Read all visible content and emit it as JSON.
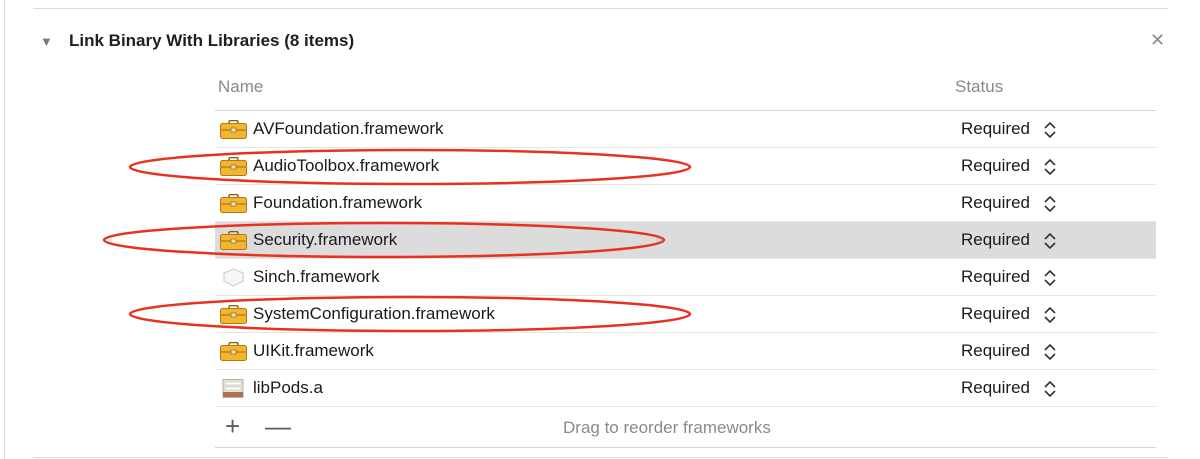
{
  "section": {
    "title": "Link Binary With Libraries (8 items)",
    "disclosure_icon": "disclosure-triangle-down",
    "close_icon": "close-x"
  },
  "table": {
    "col_name": "Name",
    "col_status": "Status",
    "rows": [
      {
        "name": "AVFoundation.framework",
        "status": "Required",
        "icon": "toolbox-icon",
        "selected": false
      },
      {
        "name": "AudioToolbox.framework",
        "status": "Required",
        "icon": "toolbox-icon",
        "selected": false
      },
      {
        "name": "Foundation.framework",
        "status": "Required",
        "icon": "toolbox-icon",
        "selected": false
      },
      {
        "name": "Security.framework",
        "status": "Required",
        "icon": "toolbox-icon",
        "selected": true
      },
      {
        "name": "Sinch.framework",
        "status": "Required",
        "icon": "generic-framework-icon",
        "selected": false
      },
      {
        "name": "SystemConfiguration.framework",
        "status": "Required",
        "icon": "toolbox-icon",
        "selected": false
      },
      {
        "name": "UIKit.framework",
        "status": "Required",
        "icon": "toolbox-icon",
        "selected": false
      },
      {
        "name": "libPods.a",
        "status": "Required",
        "icon": "archive-icon",
        "selected": false
      }
    ]
  },
  "footer": {
    "add_label": "+",
    "remove_label": "—",
    "hint": "Drag to reorder frameworks"
  },
  "colors": {
    "annotation_red": "#e8321f",
    "selected_row": "#dcdcdc",
    "toolbox_gold": "#f2b630"
  }
}
